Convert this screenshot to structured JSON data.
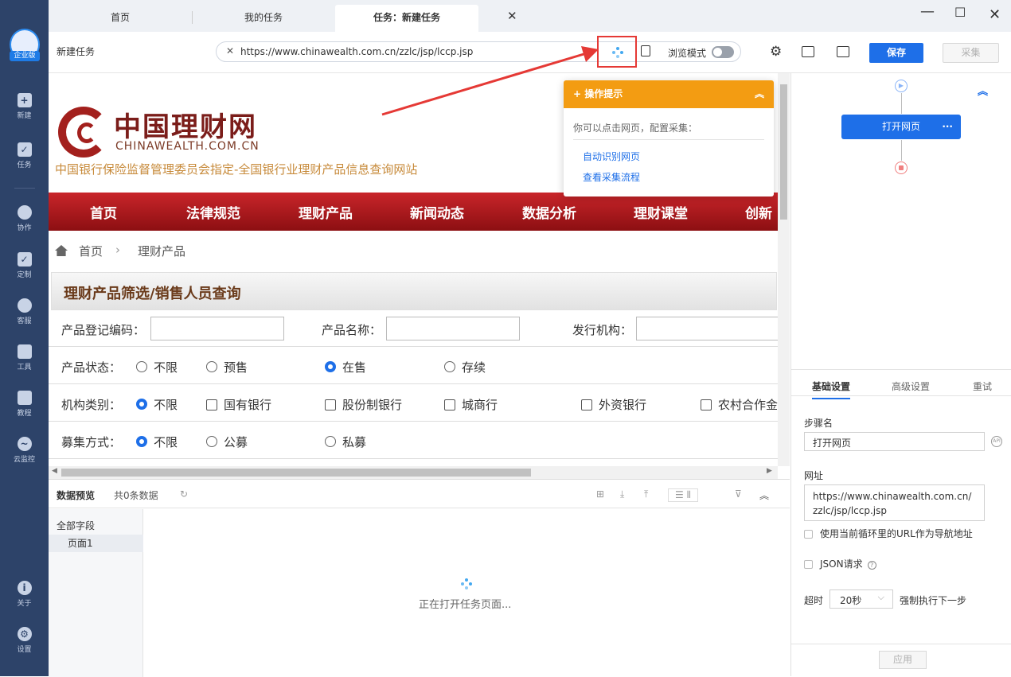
{
  "sidebar": {
    "badge": "企业版",
    "items": [
      {
        "label": "新建",
        "icon": "plus-icon"
      },
      {
        "label": "任务",
        "icon": "task-icon"
      },
      {
        "label": "协作",
        "icon": "collaborate-icon"
      },
      {
        "label": "定制",
        "icon": "heart-check-icon"
      },
      {
        "label": "客服",
        "icon": "headset-icon"
      },
      {
        "label": "工具",
        "icon": "toolbox-icon"
      },
      {
        "label": "教程",
        "icon": "graduation-cap-icon"
      },
      {
        "label": "云监控",
        "icon": "cloud-monitor-icon"
      }
    ],
    "bottom": [
      {
        "label": "关于",
        "icon": "info-icon"
      },
      {
        "label": "设置",
        "icon": "gear-icon"
      }
    ]
  },
  "tabs": [
    {
      "label": "首页"
    },
    {
      "label": "我的任务"
    },
    {
      "label": "任务：新建任务"
    }
  ],
  "toolbar": {
    "title": "新建任务",
    "url": "https://www.chinawealth.com.cn/zzlc/jsp/lccp.jsp",
    "browse_mode": "浏览模式",
    "save": "保存",
    "collect": "采集"
  },
  "website": {
    "brand_cn": "中国理财网",
    "brand_en": "CHINAWEALTH.COM.CN",
    "tagline": "中国银行保险监督管理委员会指定-全国银行业理财产品信息查询网站",
    "nav": [
      "首页",
      "法律规范",
      "理财产品",
      "新闻动态",
      "数据分析",
      "理财课堂",
      "创新"
    ],
    "breadcrumb": {
      "home": "首页",
      "sep": "›",
      "current": "理财产品"
    },
    "search_title": "理财产品筛选/销售人员查询",
    "row1": {
      "code_label": "产品登记编码：",
      "name_label": "产品名称：",
      "issuer_label": "发行机构："
    },
    "status": {
      "label": "产品状态：",
      "options": [
        "不限",
        "预售",
        "在售",
        "存续"
      ],
      "selected": "在售"
    },
    "inst_type": {
      "label": "机构类别：",
      "all": "不限",
      "options": [
        "国有银行",
        "股份制银行",
        "城商行",
        "外资银行",
        "农村合作金"
      ]
    },
    "raise": {
      "label": "募集方式：",
      "options": [
        "不限",
        "公募",
        "私募"
      ],
      "selected": "不限"
    }
  },
  "tip": {
    "title": "操作提示",
    "text": "你可以点击网页，配置采集：",
    "links": [
      "自动识别网页",
      "查看采集流程"
    ]
  },
  "preview": {
    "title": "数据预览",
    "count": "共0条数据",
    "all_fields": "全部字段",
    "page": "页面1",
    "loading": "正在打开任务页面..."
  },
  "flow": {
    "step": "打开网页"
  },
  "settings": {
    "tabs": [
      "基础设置",
      "高级设置",
      "重试"
    ],
    "step_name_label": "步骤名",
    "step_name": "打开网页",
    "url_label": "网址",
    "url": "https://www.chinawealth.com.cn/zzlc/jsp/lccp.jsp",
    "use_loop_url": "使用当前循环里的URL作为导航地址",
    "json_request": "JSON请求",
    "timeout_label": "超时",
    "timeout_value": "20秒",
    "force_next": "强制执行下一步",
    "apply": "应用"
  },
  "colors": {
    "sidebar": "#2d4369",
    "accent": "#1e6fe8",
    "tip_header": "#f39c12",
    "site_red": "#b41a1e",
    "highlight": "#e53935"
  }
}
